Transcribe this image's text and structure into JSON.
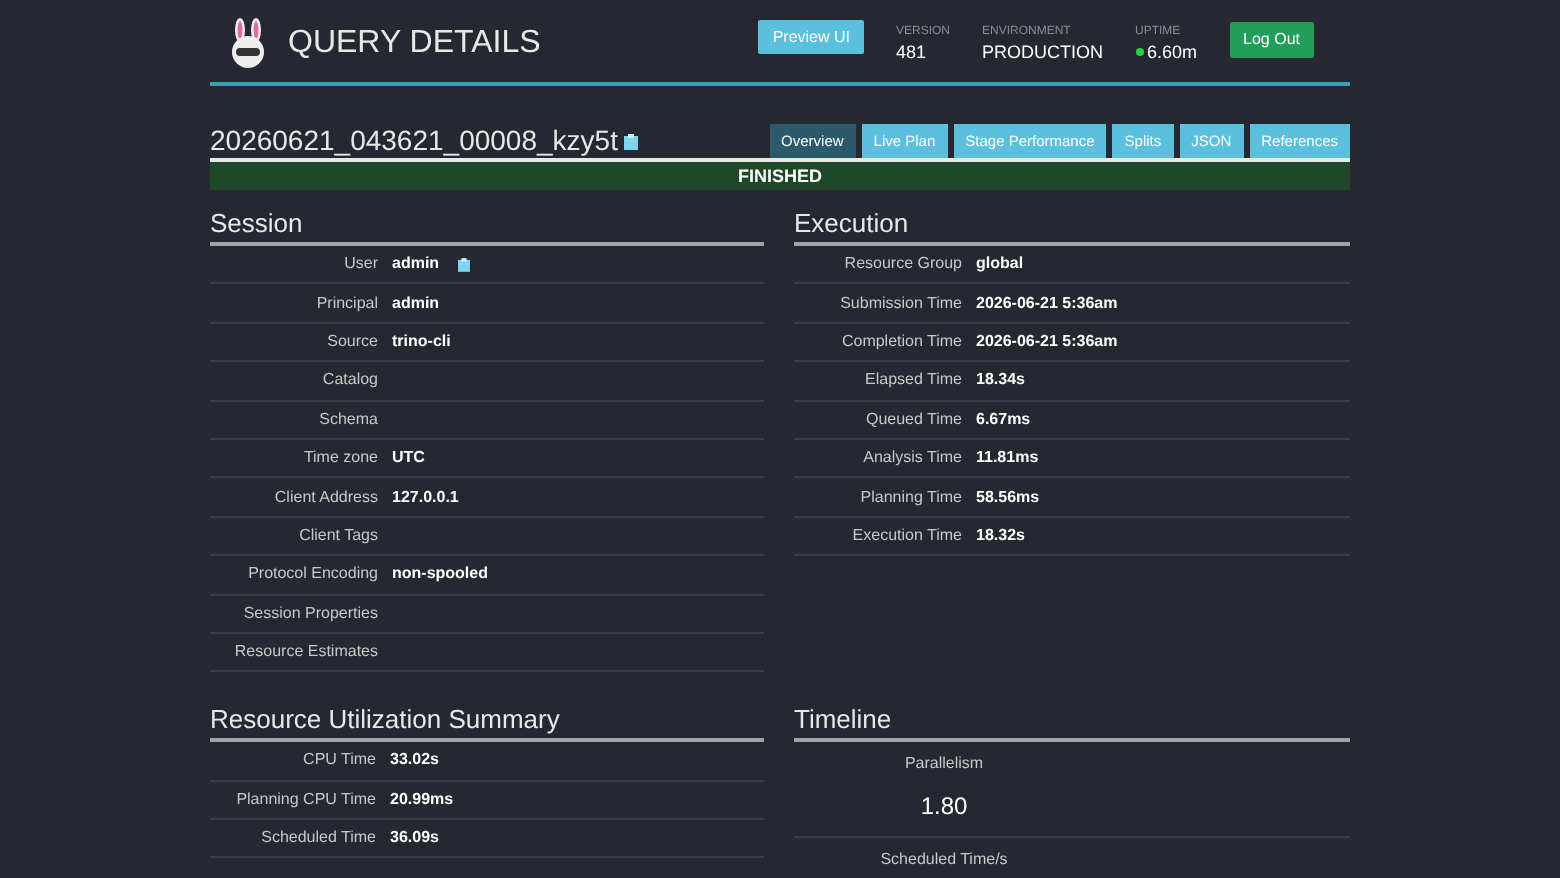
{
  "header": {
    "title": "QUERY DETAILS",
    "preview_button": "Preview UI",
    "stats": [
      {
        "label": "VERSION",
        "value": "481",
        "status_dot": false
      },
      {
        "label": "ENVIRONMENT",
        "value": "PRODUCTION",
        "status_dot": false
      },
      {
        "label": "UPTIME",
        "value": "6.60m",
        "status_dot": true
      }
    ],
    "logout_button": "Log Out"
  },
  "query": {
    "id": "20260621_043621_00008_kzy5t",
    "state": "FINISHED"
  },
  "tabs": [
    {
      "label": "Overview",
      "selected": true
    },
    {
      "label": "Live Plan",
      "selected": false
    },
    {
      "label": "Stage Performance",
      "selected": false
    },
    {
      "label": "Splits",
      "selected": false
    },
    {
      "label": "JSON",
      "selected": false
    },
    {
      "label": "References",
      "selected": false
    }
  ],
  "session": {
    "title": "Session",
    "rows": [
      {
        "label": "User",
        "value": "admin",
        "copy": true
      },
      {
        "label": "Principal",
        "value": "admin",
        "copy": false
      },
      {
        "label": "Source",
        "value": "trino-cli",
        "copy": false
      },
      {
        "label": "Catalog",
        "copy": false
      },
      {
        "label": "Schema",
        "copy": false
      },
      {
        "label": "Time zone",
        "value": "UTC",
        "copy": false
      },
      {
        "label": "Client Address",
        "value": "127.0.0.1",
        "copy": false
      },
      {
        "label": "Client Tags",
        "copy": false
      },
      {
        "label": "Protocol Encoding",
        "value": "non-spooled",
        "copy": false
      },
      {
        "label": "Session Properties",
        "copy": false
      },
      {
        "label": "Resource Estimates",
        "copy": false
      }
    ]
  },
  "execution": {
    "title": "Execution",
    "rows": [
      {
        "label": "Resource Group",
        "value": "global"
      },
      {
        "label": "Submission Time",
        "value": "2026-06-21 5:36am"
      },
      {
        "label": "Completion Time",
        "value": "2026-06-21 5:36am"
      },
      {
        "label": "Elapsed Time",
        "value": "18.34s"
      },
      {
        "label": "Queued Time",
        "value": "6.67ms"
      },
      {
        "label": "Analysis Time",
        "value": "11.81ms"
      },
      {
        "label": "Planning Time",
        "value": "58.56ms"
      },
      {
        "label": "Execution Time",
        "value": "18.32s"
      }
    ]
  },
  "resource_summary": {
    "title": "Resource Utilization Summary",
    "rows": [
      {
        "label": "CPU Time",
        "value": "33.02s"
      },
      {
        "label": "Planning CPU Time",
        "value": "20.99ms"
      },
      {
        "label": "Scheduled Time",
        "value": "36.09s"
      }
    ]
  },
  "timeline": {
    "title": "Timeline",
    "items": [
      {
        "label": "Parallelism",
        "value": "1.80"
      },
      {
        "label": "Scheduled Time/s"
      }
    ]
  }
}
